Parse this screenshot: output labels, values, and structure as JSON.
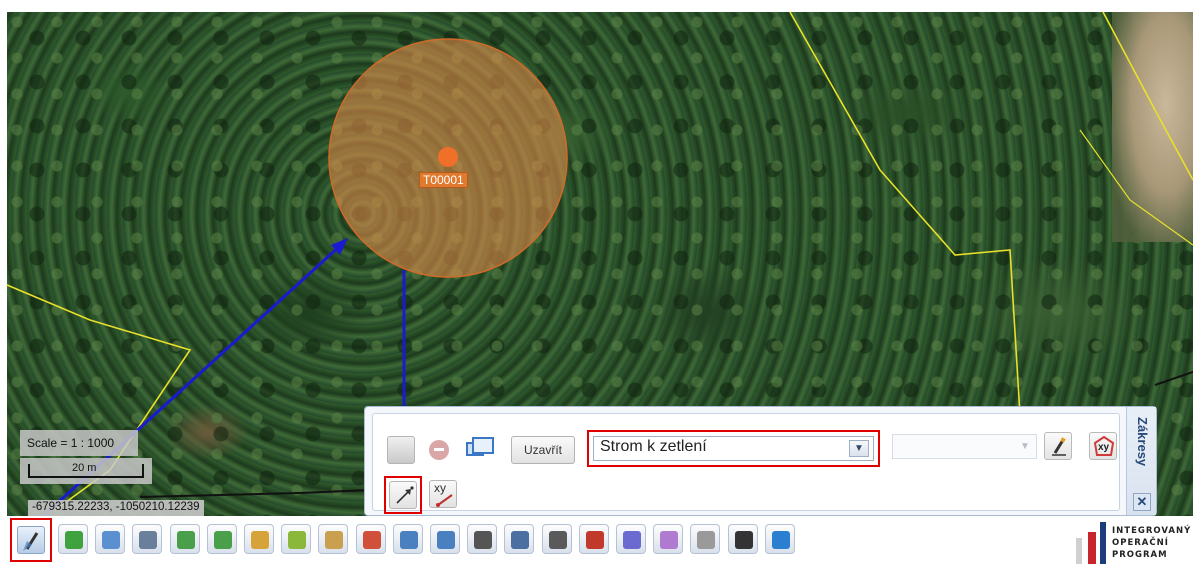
{
  "map": {
    "feature_label": "T00001",
    "scale_text": "Scale = 1 : 1000",
    "scale_bar_label": "20 m",
    "coordinates": "-679315.22233, -1050210.12239"
  },
  "panel": {
    "title": "Zákresy",
    "close_button_label": "Uzavřít",
    "selected_type": "Strom k zetlení",
    "xy_button_label": "xy",
    "close_icon_glyph": "✕"
  },
  "toolbar": {
    "icons": [
      {
        "name": "draw-tool-icon",
        "color": "#4a7fc0"
      },
      {
        "name": "refresh-icon",
        "color": "#3fa23f"
      },
      {
        "name": "window-icon",
        "color": "#5a8fd0"
      },
      {
        "name": "measure-icon",
        "color": "#6a7f9a"
      },
      {
        "name": "back-icon",
        "color": "#4aa04a"
      },
      {
        "name": "forward-icon",
        "color": "#4aa04a"
      },
      {
        "name": "ruler-icon",
        "color": "#d6a33a"
      },
      {
        "name": "layers-icon",
        "color": "#8ab83a"
      },
      {
        "name": "clear-icon",
        "color": "#c9a050"
      },
      {
        "name": "export-icon",
        "color": "#d0503a"
      },
      {
        "name": "document-icon",
        "color": "#4a7fc0"
      },
      {
        "name": "notes-icon",
        "color": "#4a7fc0"
      },
      {
        "name": "binoculars-icon",
        "color": "#555555"
      },
      {
        "name": "print-icon",
        "color": "#4a6fa0"
      },
      {
        "name": "print-preview-icon",
        "color": "#5a5a5a"
      },
      {
        "name": "print-pdf-icon",
        "color": "#c0392b"
      },
      {
        "name": "help-icon",
        "color": "#6a6ad0"
      },
      {
        "name": "bookmark-icon",
        "color": "#b07ad0"
      },
      {
        "name": "settings-icon",
        "color": "#9a9a9a"
      },
      {
        "name": "eye-icon",
        "color": "#333333"
      },
      {
        "name": "globe-icon",
        "color": "#2a7fd0"
      }
    ]
  },
  "logo": {
    "line1": "INTEGROVANÝ",
    "line2": "OPERAČNÍ",
    "line3": "PROGRAM"
  },
  "colors": {
    "highlight": "#e00000",
    "arrow": "#1a1ad0",
    "buffer_fill": "#e08a4a",
    "boundary": "#e8e02a"
  }
}
